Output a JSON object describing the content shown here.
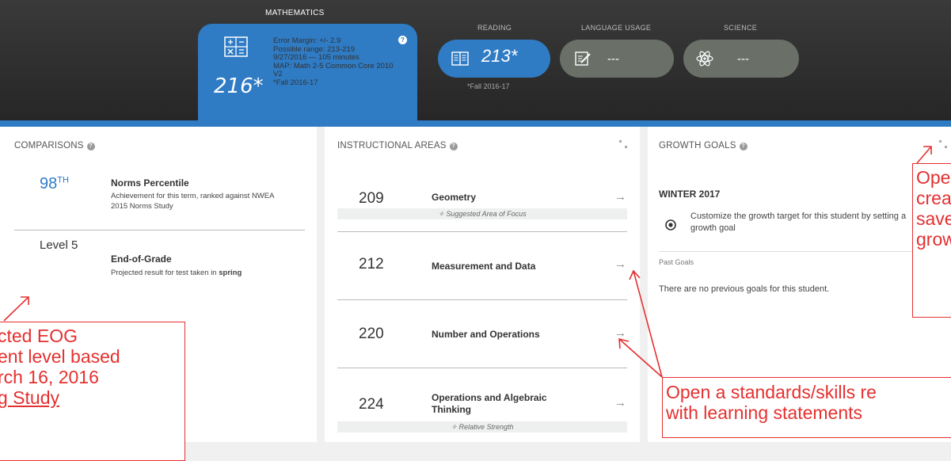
{
  "subjects": {
    "math": {
      "label": "MATHEMATICS",
      "score": "216*",
      "error_margin": "Error Margin: +/- 2.9",
      "range": "Possible range: 213-219",
      "date": "9/27/2016 — 105 minutes",
      "test_line1": "MAP: Math 2-5 Common Core 2010",
      "test_line2": "V2",
      "term": "*Fall 2016-17",
      "help": "?"
    },
    "reading": {
      "label": "READING",
      "score": "213*",
      "term": "*Fall 2016-17"
    },
    "language": {
      "label": "LANGUAGE USAGE",
      "score": "---"
    },
    "science": {
      "label": "SCIENCE",
      "score": "---"
    }
  },
  "comparisons": {
    "title": "COMPARISONS",
    "help": "?",
    "percentile": {
      "value": "98",
      "suffix": "TH",
      "title": "Norms Percentile",
      "desc_line1": "Achievement for this term, ranked against NWEA",
      "desc_line2": "2015 Norms Study"
    },
    "eog": {
      "value": "Level 5",
      "title": "End-of-Grade",
      "desc_prefix": "Projected result for test taken in ",
      "desc_bold": "spring"
    }
  },
  "instructional": {
    "title": "INSTRUCTIONAL AREAS",
    "help": "?",
    "items": [
      {
        "score": "209",
        "name": "Geometry",
        "name2": "",
        "note": "Suggested Area of Focus"
      },
      {
        "score": "212",
        "name": "Measurement and Data",
        "name2": "",
        "note": ""
      },
      {
        "score": "220",
        "name": "Number and Operations",
        "name2": "",
        "note": ""
      },
      {
        "score": "224",
        "name": "Operations and Algebraic",
        "name2": "Thinking",
        "note": "Relative Strength"
      }
    ],
    "arrow": "→"
  },
  "growth": {
    "title": "GROWTH GOALS",
    "help": "?",
    "season": "WINTER 2017",
    "goal_text": "Customize the growth target for this student by setting a growth goal",
    "past_label": "Past Goals",
    "no_goals": "There are no previous goals for this student."
  },
  "annotations": {
    "eog": [
      "cted EOG",
      "ent level based",
      "rch 16, 2016",
      "g Study"
    ],
    "growth": [
      "Oper",
      "creat",
      "save",
      "grow"
    ],
    "standards": [
      "Open a standards/skills re",
      "with learning statements"
    ]
  },
  "colors": {
    "accent": "#2f7bc4",
    "annotation": "#e53030",
    "header": "#2e2e2e"
  }
}
